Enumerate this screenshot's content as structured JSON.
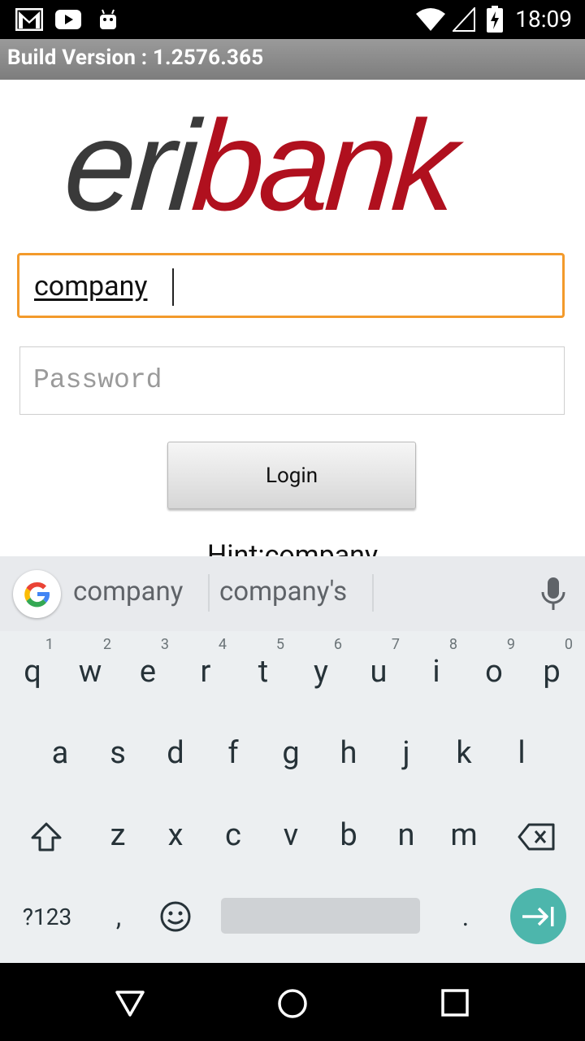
{
  "status_bar": {
    "time": "18:09",
    "icons": [
      "gmail-icon",
      "youtube-icon",
      "android-icon",
      "wifi-icon",
      "cellular-icon",
      "battery-charging-icon"
    ]
  },
  "build_bar": {
    "text": "Build Version : 1.2576.365"
  },
  "logo": {
    "part1": "eri",
    "part2": "bank",
    "color_dark": "#3a3a3a",
    "color_red": "#b0101e"
  },
  "login_form": {
    "username_value": "company",
    "password_placeholder": "Password",
    "login_label": "Login",
    "hint_text": "Hint:company"
  },
  "keyboard": {
    "suggestions": [
      "company",
      "company's"
    ],
    "row1": [
      {
        "k": "q",
        "n": "1"
      },
      {
        "k": "w",
        "n": "2"
      },
      {
        "k": "e",
        "n": "3"
      },
      {
        "k": "r",
        "n": "4"
      },
      {
        "k": "t",
        "n": "5"
      },
      {
        "k": "y",
        "n": "6"
      },
      {
        "k": "u",
        "n": "7"
      },
      {
        "k": "i",
        "n": "8"
      },
      {
        "k": "o",
        "n": "9"
      },
      {
        "k": "p",
        "n": "0"
      }
    ],
    "row2": [
      "a",
      "s",
      "d",
      "f",
      "g",
      "h",
      "j",
      "k",
      "l"
    ],
    "row3": [
      "z",
      "x",
      "c",
      "v",
      "b",
      "n",
      "m"
    ],
    "symbols_label": "?123",
    "comma": ",",
    "period": ".",
    "accent": "#4db6ac"
  },
  "colors": {
    "focus_border": "#f39a2b"
  }
}
